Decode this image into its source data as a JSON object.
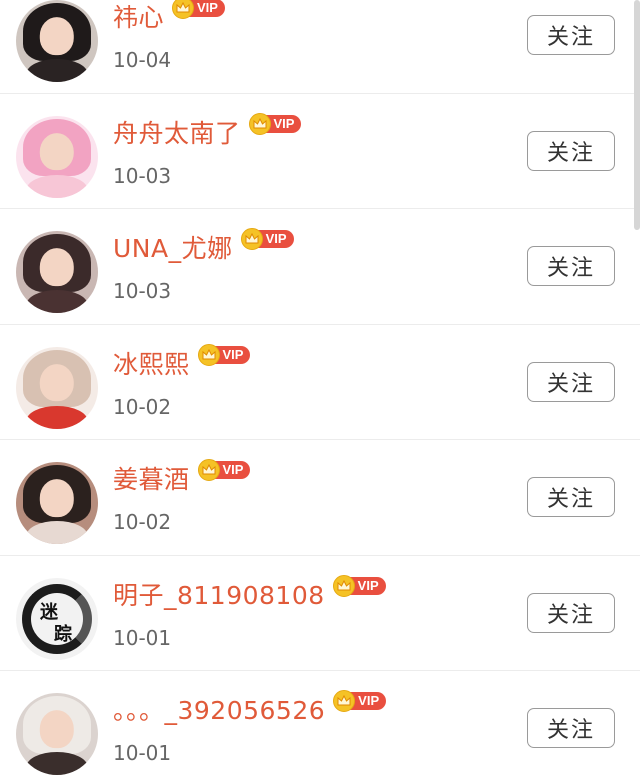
{
  "follow_label": "关注",
  "vip_label": "VIP",
  "users": [
    {
      "name": "祎心",
      "date": "10-04",
      "hair": "#1f1a1a",
      "bg": "#cfc6c0",
      "shirt": "#2a2323"
    },
    {
      "name": "舟舟太南了",
      "date": "10-03",
      "hair": "#f2a3c2",
      "bg": "#fbe3ee",
      "shirt": "#f7c6d6"
    },
    {
      "name": "UNA_尤娜",
      "date": "10-03",
      "hair": "#3b2a2a",
      "bg": "#c9b7b3",
      "shirt": "#4a3232"
    },
    {
      "name": "冰熙熙",
      "date": "10-02",
      "hair": "#d8c1b2",
      "bg": "#f4ebe6",
      "shirt": "#d9382e"
    },
    {
      "name": "姜暮酒",
      "date": "10-02",
      "hair": "#2b211e",
      "bg": "#b68d7d",
      "shirt": "#e7d9d2"
    },
    {
      "name": "明子_811908108",
      "date": "10-01",
      "hair": "#1b1b1b",
      "bg": "#e6e6e6",
      "shirt": "#222222",
      "ink": true,
      "ink_text": [
        "迷",
        "踪"
      ]
    },
    {
      "name": "。。。_392056526",
      "date": "10-01",
      "hair": "#eeeae6",
      "bg": "#dbd3cf",
      "shirt": "#3a2e2c"
    }
  ],
  "colors": {
    "name": "#e05a39",
    "vip_tag": "#e94f3f",
    "crown": "#f5c226"
  }
}
